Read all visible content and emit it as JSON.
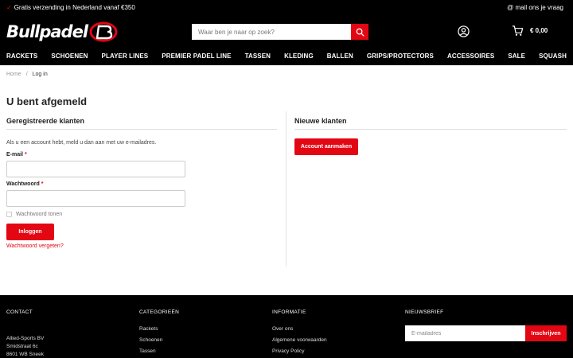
{
  "topbar": {
    "shipping_text": "Gratis verzending in Nederland vanaf €350",
    "mail_text": "@ mail ons je vraag"
  },
  "header": {
    "logo_text": "Bullpadel",
    "search_placeholder": "Waar ben je naar op zoek?",
    "cart_total": "€ 0,00"
  },
  "nav": {
    "items": [
      "RACKETS",
      "SCHOENEN",
      "PLAYER LINES",
      "PREMIER PADEL LINE",
      "TASSEN",
      "KLEDING",
      "BALLEN",
      "GRIPS/PROTECTORS",
      "ACCESSOIRES",
      "SALE",
      "SQUASH"
    ]
  },
  "breadcrumb": {
    "home": "Home",
    "separator": "/",
    "current": "Log in"
  },
  "main": {
    "title": "U bent afgemeld",
    "registered": {
      "title": "Geregistreerde klanten",
      "intro": "Als u een account hebt, meld u dan aan met uw e-mailadres.",
      "email_label": "E-mail",
      "password_label": "Wachtwoord",
      "required_mark": "*",
      "show_password": "Wachtwoord tonen",
      "login_button": "Inloggen",
      "forgot_link": "Wachtwoord vergeten?"
    },
    "new_customers": {
      "title": "Nieuwe klanten",
      "create_button": "Account aanmaken"
    }
  },
  "footer": {
    "contact": {
      "title": "CONTACT",
      "lines": [
        "Allied-Sports BV",
        "Smidstraat 6c",
        "8601 WB Sneek"
      ]
    },
    "categories": {
      "title": "CATEGORIEËN",
      "items": [
        "Rackets",
        "Schoenen",
        "Tassen"
      ]
    },
    "info": {
      "title": "INFORMATIE",
      "items": [
        "Over ons",
        "Algemene voorwaarden",
        "Privacy Policy"
      ]
    },
    "newsletter": {
      "title": "NIEUWSBRIEF",
      "placeholder": "E-mailadres",
      "button": "Inschrijven"
    }
  },
  "colors": {
    "brand_red": "#e30613",
    "header_bg": "#000000"
  }
}
